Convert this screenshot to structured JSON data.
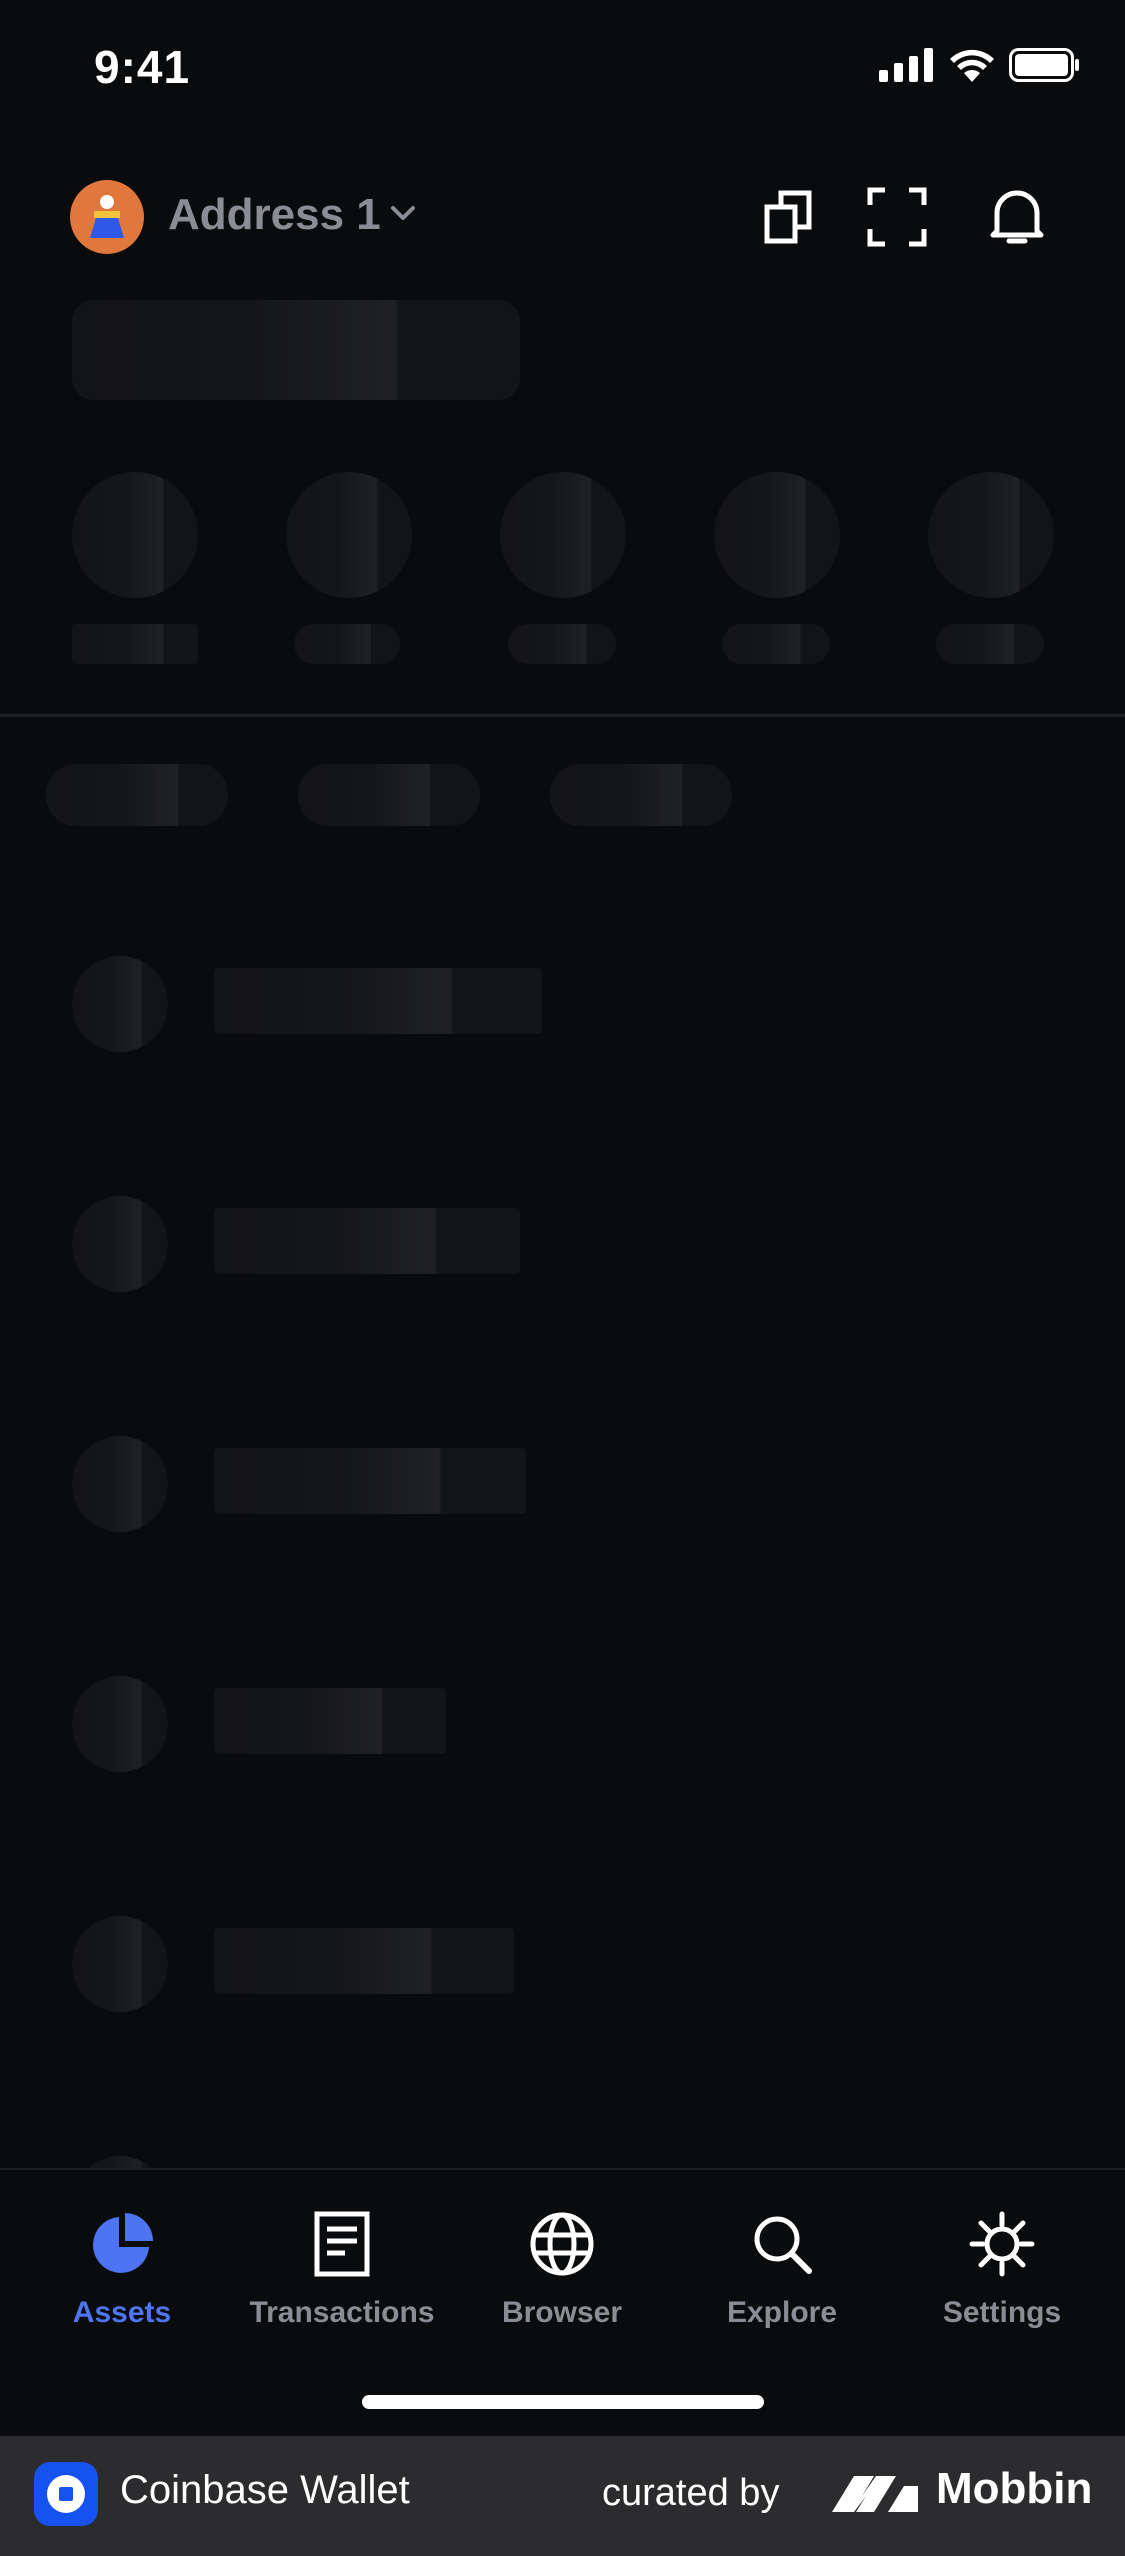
{
  "status_bar": {
    "time": "9:41",
    "icons": [
      "signal-icon",
      "wifi-icon",
      "battery-icon"
    ]
  },
  "header": {
    "address_label": "Address 1",
    "icons": [
      "chevron-down-icon",
      "copy-icon",
      "scan-icon",
      "bell-icon"
    ]
  },
  "tabbar": {
    "tabs": [
      {
        "label": "Assets",
        "icon": "pie-chart-icon",
        "active": true
      },
      {
        "label": "Transactions",
        "icon": "document-icon",
        "active": false
      },
      {
        "label": "Browser",
        "icon": "globe-icon",
        "active": false
      },
      {
        "label": "Explore",
        "icon": "search-icon",
        "active": false
      },
      {
        "label": "Settings",
        "icon": "gear-icon",
        "active": false
      }
    ]
  },
  "footer": {
    "app_name": "Coinbase Wallet",
    "curated_by": "curated by",
    "brand": "Mobbin"
  },
  "colors": {
    "background": "#0a0b0d",
    "accent": "#4d74f2",
    "inactive": "#8a8d94",
    "footer_bg": "#2c2c2e",
    "coinbase_blue": "#1652f0",
    "avatar": "#e0783d"
  }
}
